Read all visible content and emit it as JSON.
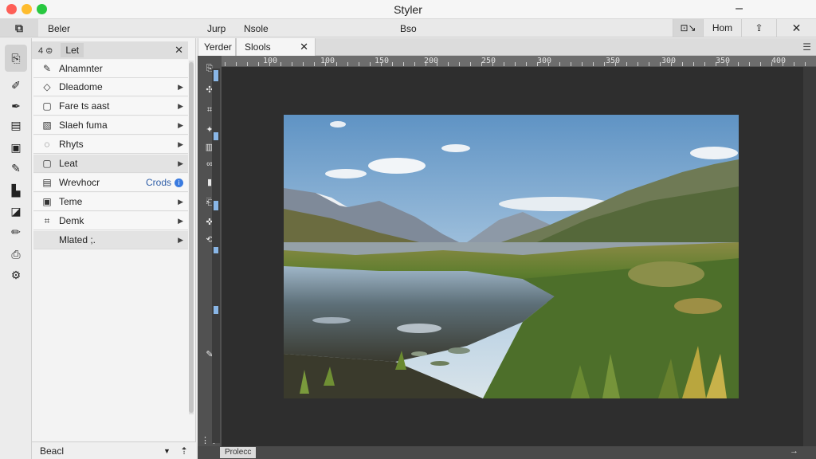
{
  "window": {
    "title": "Styler"
  },
  "menubar": {
    "logo": "⧉",
    "items": [
      "Beler",
      "Jurp",
      "Nsole",
      "Bso"
    ],
    "right": [
      "Hom"
    ]
  },
  "tools": [
    "pages-icon",
    "brush-icon",
    "pen-icon",
    "layers-icon",
    "frame-icon",
    "eyedropper-icon",
    "bookmark-icon",
    "stamp-icon",
    "pencil-icon",
    "printer-icon",
    "settings-icon"
  ],
  "panel": {
    "header_num": "4 ⊜",
    "header_label": "Let",
    "rows": [
      {
        "label": "Alnamnter",
        "icon": "✎"
      },
      {
        "label": "Dleadome",
        "icon": "◇"
      },
      {
        "label": "Fare ts aast",
        "icon": "▢"
      },
      {
        "label": "Slaeh fuma",
        "icon": "▧"
      },
      {
        "label": "Rhyts",
        "icon": "◌"
      },
      {
        "label": "Leat",
        "icon": "▢"
      },
      {
        "label": "Wrevhocr",
        "icon": "▤",
        "badge": "Crods"
      },
      {
        "label": "Teme",
        "icon": "▣"
      },
      {
        "label": "Demk",
        "icon": "⌗"
      },
      {
        "label": "Mlated ;.",
        "icon": ""
      }
    ],
    "footer_label": "Beacl"
  },
  "tabs": [
    "Yerder",
    "Slools"
  ],
  "ruler": [
    "100",
    "100",
    "150",
    "200",
    "250",
    "300",
    "350",
    "300",
    "350",
    "400"
  ],
  "status": {
    "label": "Prolecc"
  },
  "colors": {
    "accent": "#3a7be0",
    "canvas": "#2e2e2e"
  }
}
